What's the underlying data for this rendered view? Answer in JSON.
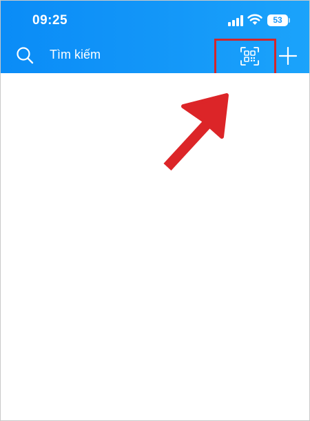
{
  "status_bar": {
    "time": "09:25",
    "battery_level": "53",
    "icons": [
      "signal-icon",
      "wifi-icon",
      "battery-icon"
    ]
  },
  "header": {
    "search_placeholder": "Tìm kiếm",
    "actions": [
      "qr-scan-icon",
      "add-icon"
    ]
  },
  "annotation": {
    "highlight_color": "#d2262b",
    "points_to": "qr-scan-icon"
  },
  "colors": {
    "header_blue": "#1295f8",
    "text_white": "#ffffff"
  }
}
